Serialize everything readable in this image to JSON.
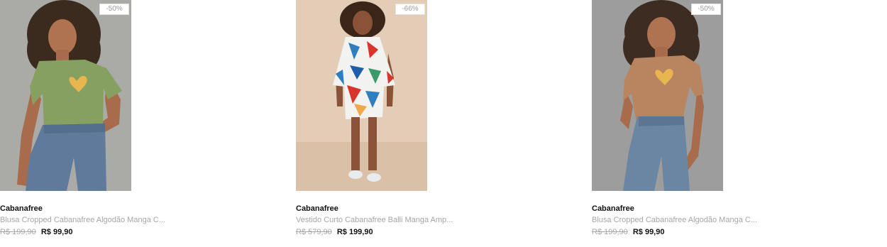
{
  "products": [
    {
      "discount": "-50%",
      "brand": "Cabanafree",
      "name": "Blusa Cropped Cabanafree Algodão Manga C...",
      "old_price": "R$ 199,90",
      "new_price": "R$ 99,90",
      "image_bg": "#a5a6a2",
      "shirt_color": "#86a062",
      "garment": "cropped-tee"
    },
    {
      "discount": "-66%",
      "brand": "Cabanafree",
      "name": "Vestido Curto Cabanafree Balli Manga Amp...",
      "old_price": "R$ 579,90",
      "new_price": "R$ 199,90",
      "image_bg": "#e3cdb6",
      "shirt_color": "#2f7fc0",
      "garment": "printed-dress"
    },
    {
      "discount": "-50%",
      "brand": "Cabanafree",
      "name": "Blusa Cropped Cabanafree Algodão Manga C...",
      "old_price": "R$ 199,90",
      "new_price": "R$ 99,90",
      "image_bg": "#9d9d9d",
      "shirt_color": "#b98560",
      "garment": "cropped-tee"
    }
  ]
}
